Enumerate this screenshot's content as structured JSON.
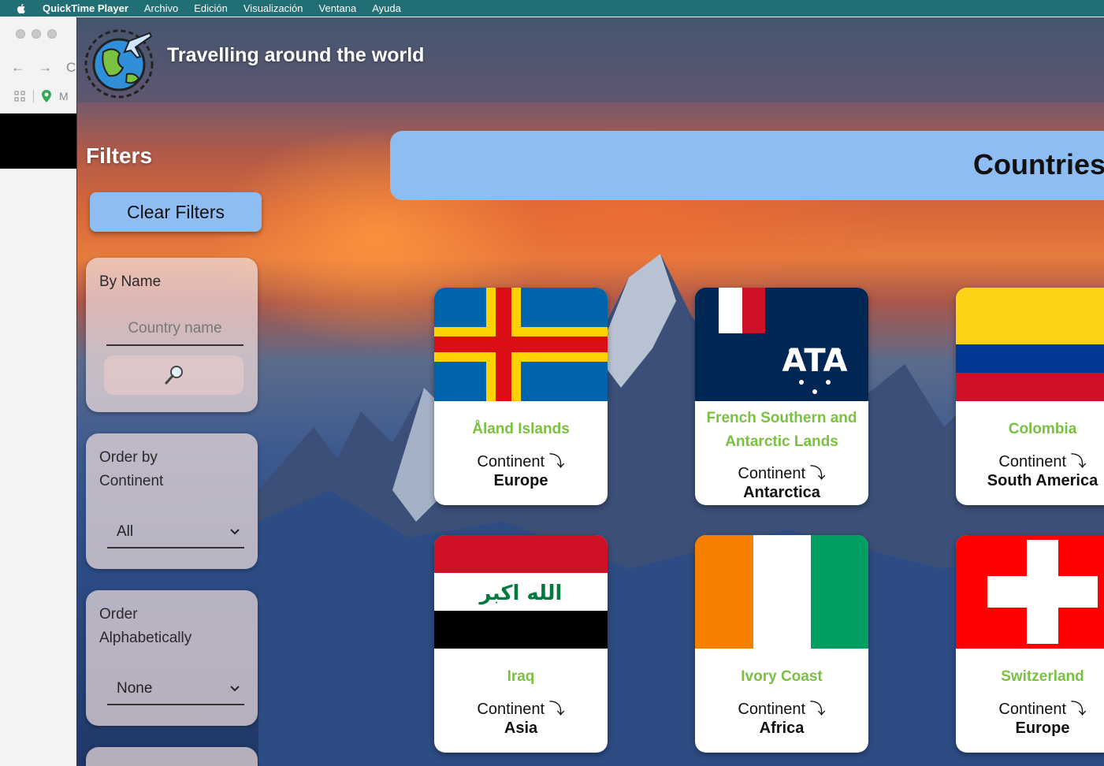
{
  "menubar": {
    "app": "QuickTime Player",
    "items": [
      "Archivo",
      "Edición",
      "Visualización",
      "Ventana",
      "Ayuda"
    ]
  },
  "browser_bg": {
    "partial_text_1": "C",
    "partial_text_2": "M"
  },
  "header": {
    "title": "Travelling around the world"
  },
  "filters": {
    "title": "Filters",
    "clear_label": "Clear Filters",
    "by_name": {
      "label": "By Name",
      "placeholder": "Country name"
    },
    "order_continent": {
      "label_line1": "Order by",
      "label_line2": "Continent",
      "value": "All"
    },
    "order_alpha": {
      "label_line1": "Order",
      "label_line2": "Alphabetically",
      "value": "None"
    }
  },
  "main": {
    "title": "Countries",
    "continent_label": "Continent ⤵",
    "cards": [
      {
        "name": "Åland Islands",
        "continent": "Europe"
      },
      {
        "name_line1": "French Southern and",
        "name_line2": "Antarctic Lands",
        "continent": "Antarctica"
      },
      {
        "name": "Colombia",
        "continent": "South America"
      },
      {
        "name": "Iraq",
        "continent": "Asia",
        "flag_text": "الله اكبر"
      },
      {
        "name": "Ivory Coast",
        "continent": "Africa"
      },
      {
        "name": "Switzerland",
        "continent": "Europe"
      }
    ]
  },
  "colors": {
    "accent": "#8ebdf3",
    "country_name": "#7ac142",
    "menubar": "#1f6f74"
  }
}
